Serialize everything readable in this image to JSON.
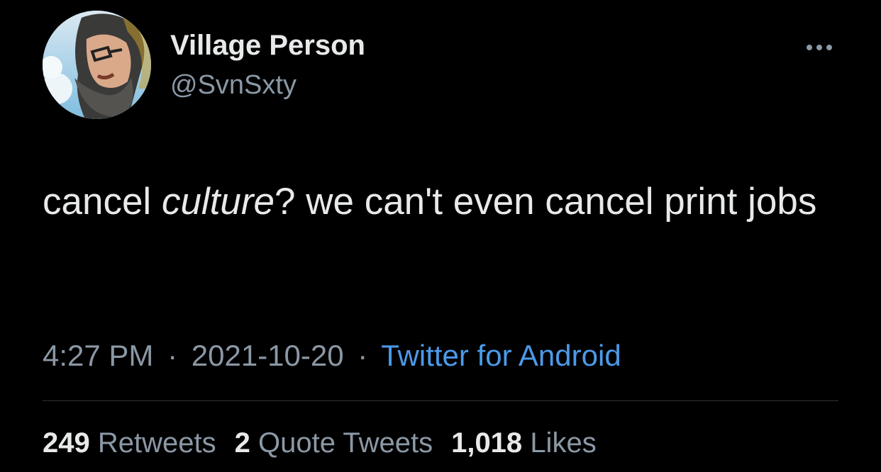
{
  "author": {
    "display_name": "Village Person",
    "handle": "@SvnSxty",
    "avatar_icon": "profile-photo-avatar"
  },
  "more_icon": "ellipsis-icon",
  "tweet": {
    "text_part1": "cancel ",
    "text_emphasis": "culture",
    "text_part2": "? we can't even cancel print jobs"
  },
  "meta": {
    "time": "4:27 PM",
    "separator": "·",
    "date": "2021-10-20",
    "source": "Twitter for Android"
  },
  "stats": {
    "retweets_count": "249",
    "retweets_label": "Retweets",
    "quotes_count": "2",
    "quotes_label": "Quote Tweets",
    "likes_count": "1,018",
    "likes_label": "Likes"
  },
  "colors": {
    "background": "#000000",
    "primary_text": "#e7e9ea",
    "secondary_text": "#8b98a5",
    "link": "#4c9ae8",
    "divider": "#2f3336"
  }
}
